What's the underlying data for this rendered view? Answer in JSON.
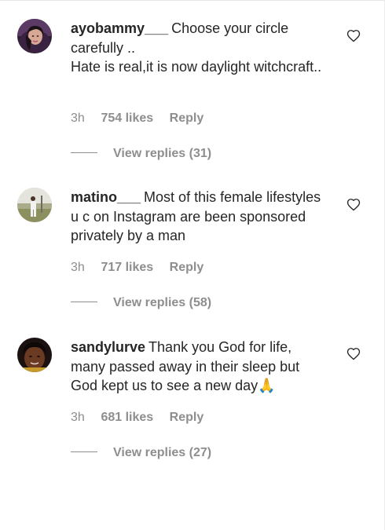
{
  "comments": [
    {
      "username": "ayobammy___",
      "text": "Choose your circle carefully ..\nHate is real,it is now daylight witchcraft..",
      "time": "3h",
      "likes": "754 likes",
      "reply": "Reply",
      "view_replies": "View replies (31)"
    },
    {
      "username": "matino___",
      "text": "Most of this female lifestyles u c on Instagram are been sponsored privately by a man",
      "time": "3h",
      "likes": "717 likes",
      "reply": "Reply",
      "view_replies": "View replies (58)"
    },
    {
      "username": "sandylurve",
      "text": "Thank you God for life, many passed away in their sleep but God kept us to see a new day🙏",
      "time": "3h",
      "likes": "681 likes",
      "reply": "Reply",
      "view_replies": "View replies (27)"
    }
  ],
  "icons": {
    "heart": "heart-outline-icon"
  },
  "colors": {
    "primary_text": "#262626",
    "secondary_text": "#8e8e8e"
  }
}
